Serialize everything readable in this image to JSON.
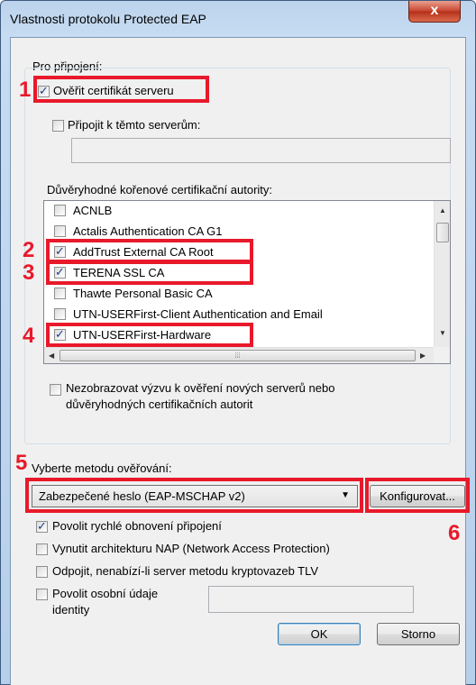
{
  "window": {
    "title": "Vlastnosti protokolu Protected EAP",
    "close_glyph": "x"
  },
  "connection": {
    "group_label": "Pro připojení:",
    "verify_cert": {
      "label": "Ověřit certifikát serveru",
      "checked": true
    },
    "connect_servers": {
      "label": "Připojit k těmto serverům:",
      "checked": false,
      "value": ""
    },
    "trusted_label": "Důvěryhodné kořenové certifikační autority:",
    "authorities": [
      {
        "label": "ACNLB",
        "checked": false
      },
      {
        "label": "Actalis Authentication CA G1",
        "checked": false
      },
      {
        "label": "AddTrust External CA Root",
        "checked": true
      },
      {
        "label": "TERENA SSL CA",
        "checked": true
      },
      {
        "label": "Thawte Personal Basic CA",
        "checked": false
      },
      {
        "label": "UTN-USERFirst-Client Authentication and Email",
        "checked": false
      },
      {
        "label": "UTN-USERFirst-Hardware",
        "checked": true
      }
    ],
    "no_prompt": {
      "label_line1": "Nezobrazovat výzvu k ověření nových serverů nebo",
      "label_line2": "důvěryhodných certifikačních autorit",
      "checked": false
    }
  },
  "auth": {
    "label": "Vyberte metodu ověřování:",
    "method": "Zabezpečené heslo (EAP-MSCHAP v2)",
    "configure_label": "Konfigurovat..."
  },
  "options": [
    {
      "label": "Povolit rychlé obnovení připojení",
      "checked": true
    },
    {
      "label": "Vynutit architekturu NAP (Network Access Protection)",
      "checked": false
    },
    {
      "label": "Odpojit, nenabízí-li server metodu kryptovazeb TLV",
      "checked": false
    }
  ],
  "identity_privacy": {
    "label_line1": "Povolit osobní údaje",
    "label_line2": "identity",
    "checked": false,
    "value": ""
  },
  "buttons": {
    "ok": "OK",
    "cancel": "Storno"
  },
  "annotations": [
    "1",
    "2",
    "3",
    "4",
    "5",
    "6"
  ],
  "colors": {
    "annotation": "#e8192a",
    "check": "#1e3f84"
  }
}
